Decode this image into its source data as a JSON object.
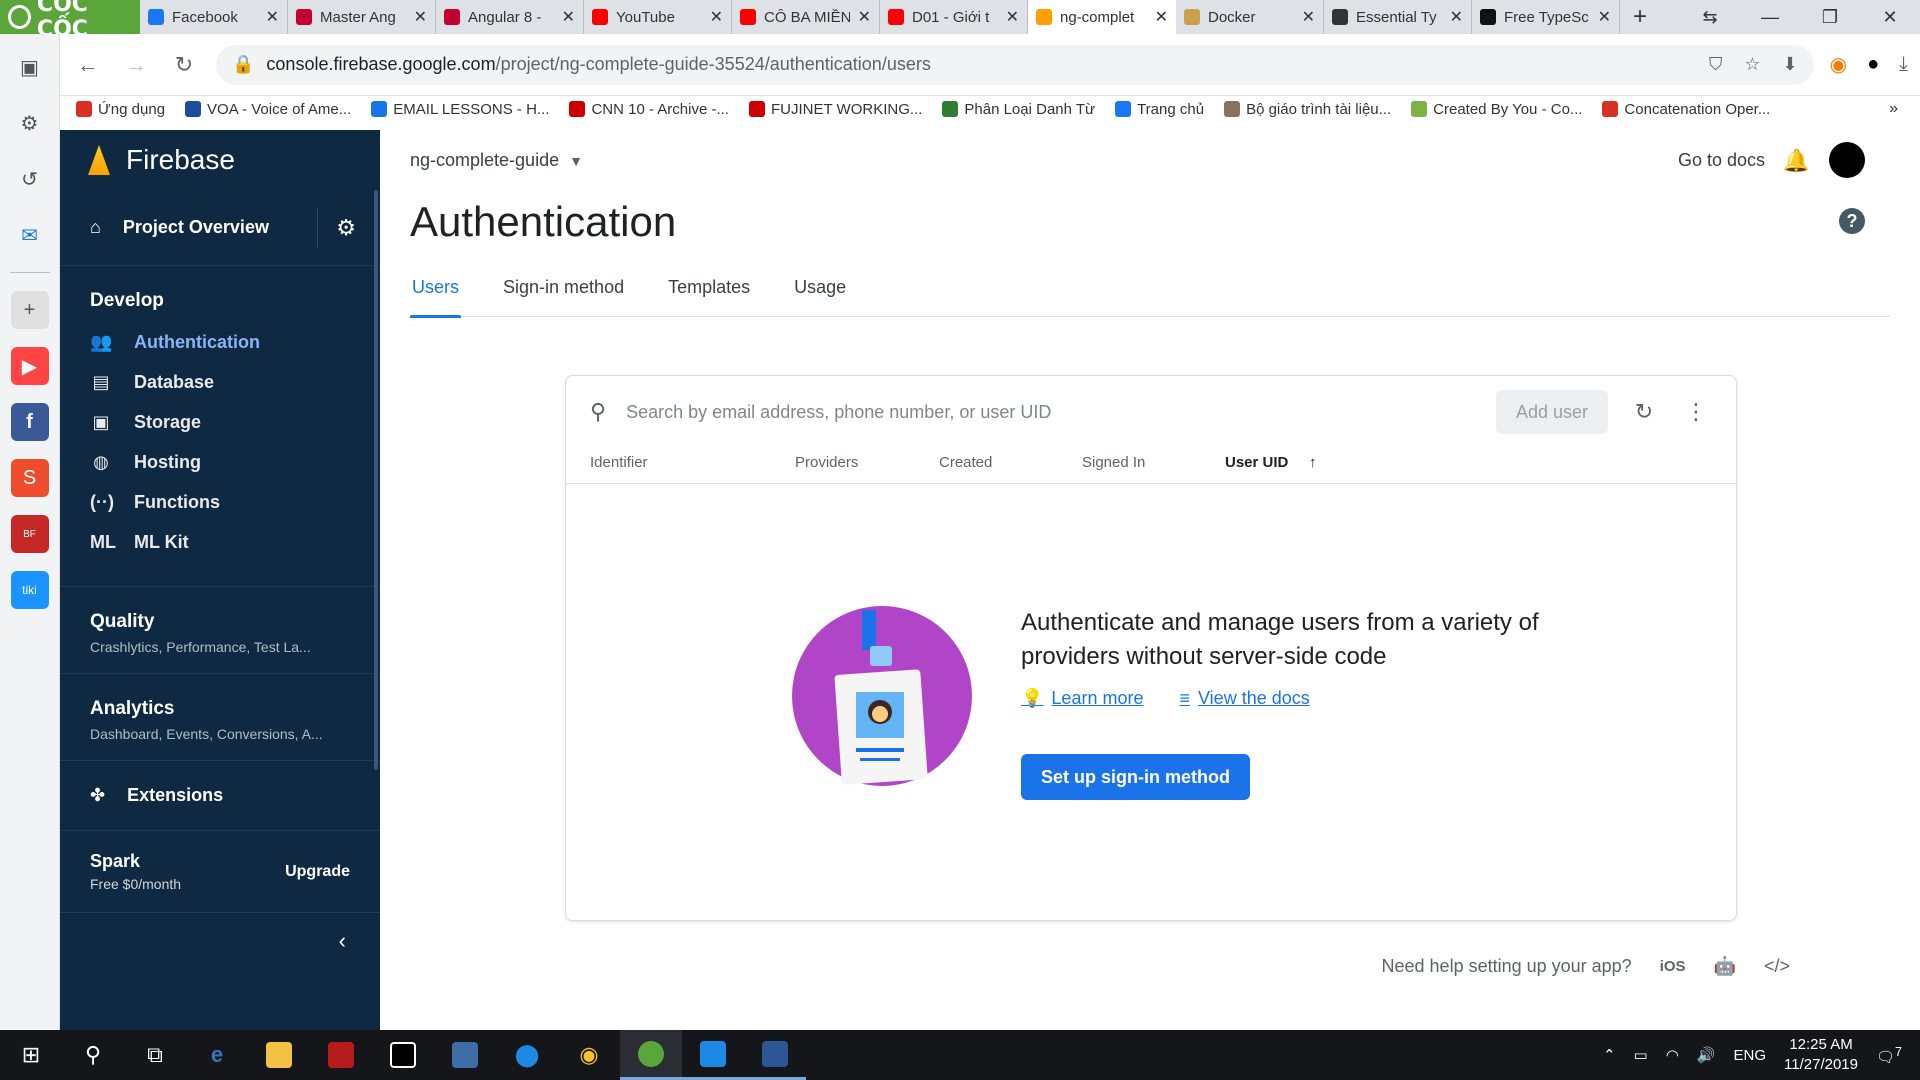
{
  "browser": {
    "brand": "CỐC CỐC",
    "tabs": [
      {
        "title": "Facebook",
        "color": "#1877f2"
      },
      {
        "title": "Master Ang",
        "color": "#c3002f"
      },
      {
        "title": "Angular 8 -",
        "color": "#c3002f"
      },
      {
        "title": "YouTube",
        "color": "#ff0000"
      },
      {
        "title": "CÔ BA MIỀN",
        "color": "#ff0000"
      },
      {
        "title": "D01 - Giới t",
        "color": "#ff0000"
      },
      {
        "title": "ng-complet",
        "color": "#ffa000",
        "active": true
      },
      {
        "title": "Docker",
        "color": "#caa04a"
      },
      {
        "title": "Essential Ty",
        "color": "#333333"
      },
      {
        "title": "Free TypeSc",
        "color": "#111111"
      }
    ],
    "url_host": "console.firebase.google.com",
    "url_path": "/project/ng-complete-guide-35524/authentication/users",
    "bookmarks": [
      {
        "label": "Ứng dụng",
        "color": "#d93025"
      },
      {
        "label": "VOA - Voice of Ame...",
        "color": "#1a4d9c"
      },
      {
        "label": "EMAIL LESSONS - H...",
        "color": "#1a73e8"
      },
      {
        "label": "CNN 10 - Archive -...",
        "color": "#cc0000"
      },
      {
        "label": "FUJINET WORKING...",
        "color": "#cc0000"
      },
      {
        "label": "Phân Loại Danh Từ",
        "color": "#2e7d32"
      },
      {
        "label": "Trang chủ",
        "color": "#1877f2"
      },
      {
        "label": "Bộ giáo trình tài liệu...",
        "color": "#8d6e63"
      },
      {
        "label": "Created By You - Co...",
        "color": "#7cb342"
      },
      {
        "label": "Concatenation Oper...",
        "color": "#d93025"
      }
    ],
    "bookmarks_more": "»"
  },
  "sidebar": {
    "brand": "Firebase",
    "overview": "Project Overview",
    "develop_heading": "Develop",
    "develop_items": [
      {
        "label": "Authentication",
        "icon": "👥",
        "active": true
      },
      {
        "label": "Database",
        "icon": "▤"
      },
      {
        "label": "Storage",
        "icon": "▣"
      },
      {
        "label": "Hosting",
        "icon": "◍"
      },
      {
        "label": "Functions",
        "icon": "(··)"
      },
      {
        "label": "ML Kit",
        "icon": "ML"
      }
    ],
    "quality_title": "Quality",
    "quality_sub": "Crashlytics, Performance, Test La...",
    "analytics_title": "Analytics",
    "analytics_sub": "Dashboard, Events, Conversions, A...",
    "extensions": "Extensions",
    "plan_name": "Spark",
    "plan_price": "Free $0/month",
    "upgrade": "Upgrade"
  },
  "header": {
    "project": "ng-complete-guide",
    "go_to_docs": "Go to docs",
    "title": "Authentication"
  },
  "tabs": [
    {
      "label": "Users",
      "active": true
    },
    {
      "label": "Sign-in method"
    },
    {
      "label": "Templates"
    },
    {
      "label": "Usage"
    }
  ],
  "users": {
    "search_placeholder": "Search by email address, phone number, or user UID",
    "add_user": "Add user",
    "columns": [
      "Identifier",
      "Providers",
      "Created",
      "Signed In",
      "User UID"
    ],
    "sorted_column": "User UID",
    "empty_message": "Authenticate and manage users from a variety of providers without server-side code",
    "learn_more": "Learn more",
    "view_docs": "View the docs",
    "setup_button": "Set up sign-in method"
  },
  "footer": {
    "need_help": "Need help setting up your app?",
    "ios": "iOS"
  },
  "taskbar": {
    "language": "ENG",
    "time": "12:25 AM",
    "date": "11/27/2019",
    "notifications": "7"
  },
  "colors": {
    "sidebar_bg": "#0f2942",
    "accent": "#1a73e8",
    "active_nav": "#8ab4f8",
    "illustration": "#b145c7"
  }
}
